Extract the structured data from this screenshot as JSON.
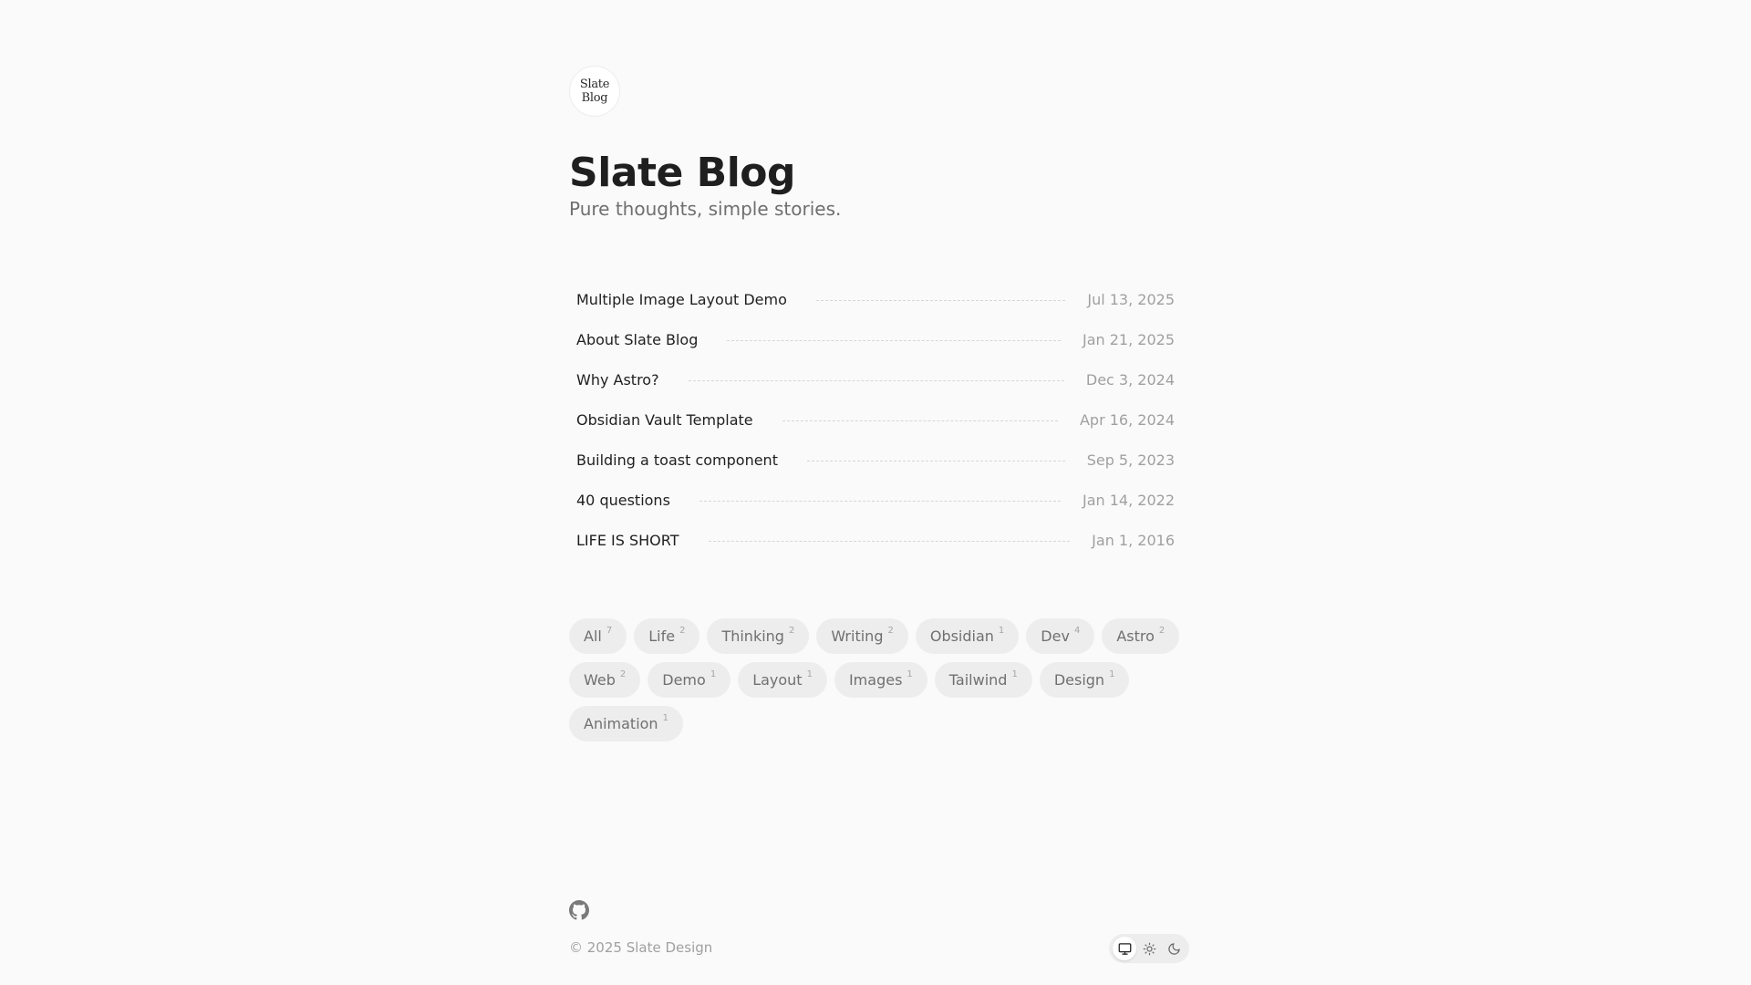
{
  "header": {
    "logo_line1": "Slate",
    "logo_line2": "Blog",
    "title": "Slate Blog",
    "tagline": "Pure thoughts, simple stories."
  },
  "posts": [
    {
      "title": "Multiple Image Layout Demo",
      "date": "Jul 13, 2025"
    },
    {
      "title": "About Slate Blog",
      "date": "Jan 21, 2025"
    },
    {
      "title": "Why Astro?",
      "date": "Dec 3, 2024"
    },
    {
      "title": "Obsidian Vault Template",
      "date": "Apr 16, 2024"
    },
    {
      "title": "Building a toast component",
      "date": "Sep 5, 2023"
    },
    {
      "title": "40 questions",
      "date": "Jan 14, 2022"
    },
    {
      "title": "LIFE IS SHORT",
      "date": "Jan 1, 2016"
    }
  ],
  "tags": [
    {
      "label": "All",
      "count": "7"
    },
    {
      "label": "Life",
      "count": "2"
    },
    {
      "label": "Thinking",
      "count": "2"
    },
    {
      "label": "Writing",
      "count": "2"
    },
    {
      "label": "Obsidian",
      "count": "1"
    },
    {
      "label": "Dev",
      "count": "4"
    },
    {
      "label": "Astro",
      "count": "2"
    },
    {
      "label": "Web",
      "count": "2"
    },
    {
      "label": "Demo",
      "count": "1"
    },
    {
      "label": "Layout",
      "count": "1"
    },
    {
      "label": "Images",
      "count": "1"
    },
    {
      "label": "Tailwind",
      "count": "1"
    },
    {
      "label": "Design",
      "count": "1"
    },
    {
      "label": "Animation",
      "count": "1"
    }
  ],
  "footer": {
    "github_icon": "github-icon",
    "copyright": "© 2025 Slate Design",
    "theme_options": [
      {
        "icon": "monitor-icon",
        "active": true
      },
      {
        "icon": "sun-icon",
        "active": false
      },
      {
        "icon": "moon-icon",
        "active": false
      }
    ]
  },
  "colors": {
    "background": "#fafafa",
    "text": "#1f1f1f",
    "muted": "#a0a0a0",
    "tag_bg": "#ededed"
  }
}
